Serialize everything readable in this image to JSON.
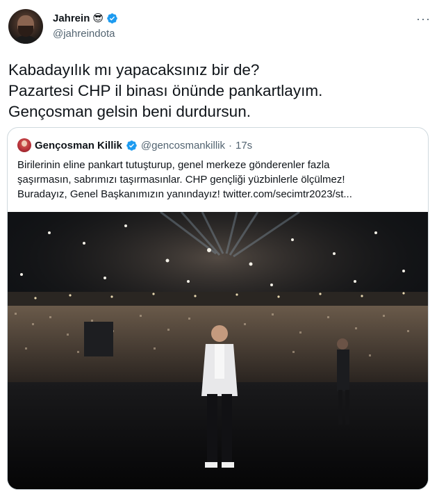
{
  "author": {
    "display_name": "Jahrein",
    "emoji": "😎",
    "handle": "@jahreindota"
  },
  "menu": {
    "more_label": "···"
  },
  "tweet": {
    "lines": [
      "Kabadayılık mı yapacaksınız bir de?",
      "Pazartesi CHP il binası önünde pankartlayım.",
      "Gençosman gelsin beni durdursun."
    ]
  },
  "quoted": {
    "display_name": "Gençosman Killik",
    "handle": "@gencosmankillik",
    "separator": "·",
    "time": "17s",
    "lines": [
      "Birilerinin eline pankart tutuşturup, genel merkeze gönderenler fazla",
      "şaşırmasın, sabrımızı taşırmasınlar. CHP gençliği yüzbinlerle ölçülmez!",
      "Buradayız, Genel Başkanımızın yanındayız!  twitter.com/secimtr2023/st..."
    ],
    "image": "stage-photo"
  },
  "colors": {
    "verified": "#1d9bf0",
    "text": "#0f1419",
    "secondary": "#536471",
    "border": "#cfd9de"
  },
  "icons": {
    "verified": "verified-badge-icon",
    "more": "more-dots-icon"
  }
}
